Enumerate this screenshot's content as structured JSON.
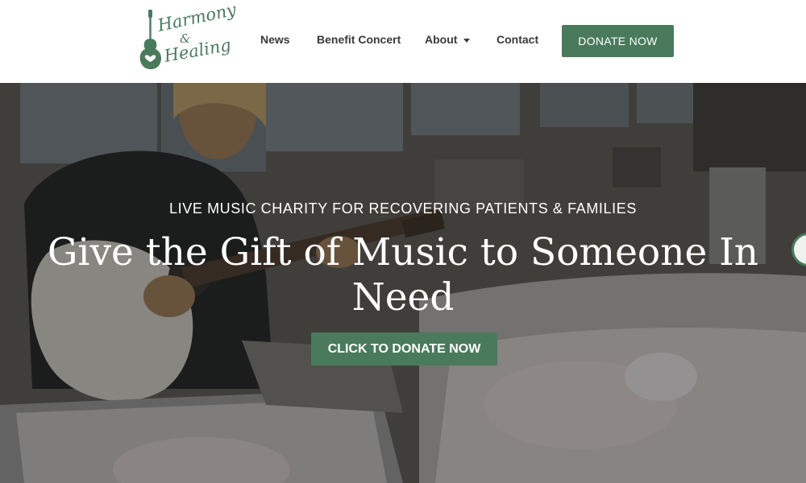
{
  "logo": {
    "line1": "Harmony",
    "line2": "&",
    "line3": "Healing",
    "icon": "guitar-heart-icon"
  },
  "nav": {
    "items": [
      {
        "label": "News"
      },
      {
        "label": "Benefit Concert"
      },
      {
        "label": "About",
        "icon": "caret-down-icon"
      },
      {
        "label": "Contact"
      }
    ],
    "donate_label": "DONATE NOW"
  },
  "hero": {
    "kicker": "LIVE MUSIC CHARITY FOR RECOVERING PATIENTS & FAMILIES",
    "title": "Give the Gift of Music to Someone In Need",
    "cta_label": "CLICK TO DONATE NOW",
    "background": "photo of a musician playing acoustic guitar beside hospital bassinets"
  },
  "colors": {
    "accent": "#4a7a5c",
    "nav_text": "#3a3a3a",
    "header_bg": "#ffffff"
  }
}
